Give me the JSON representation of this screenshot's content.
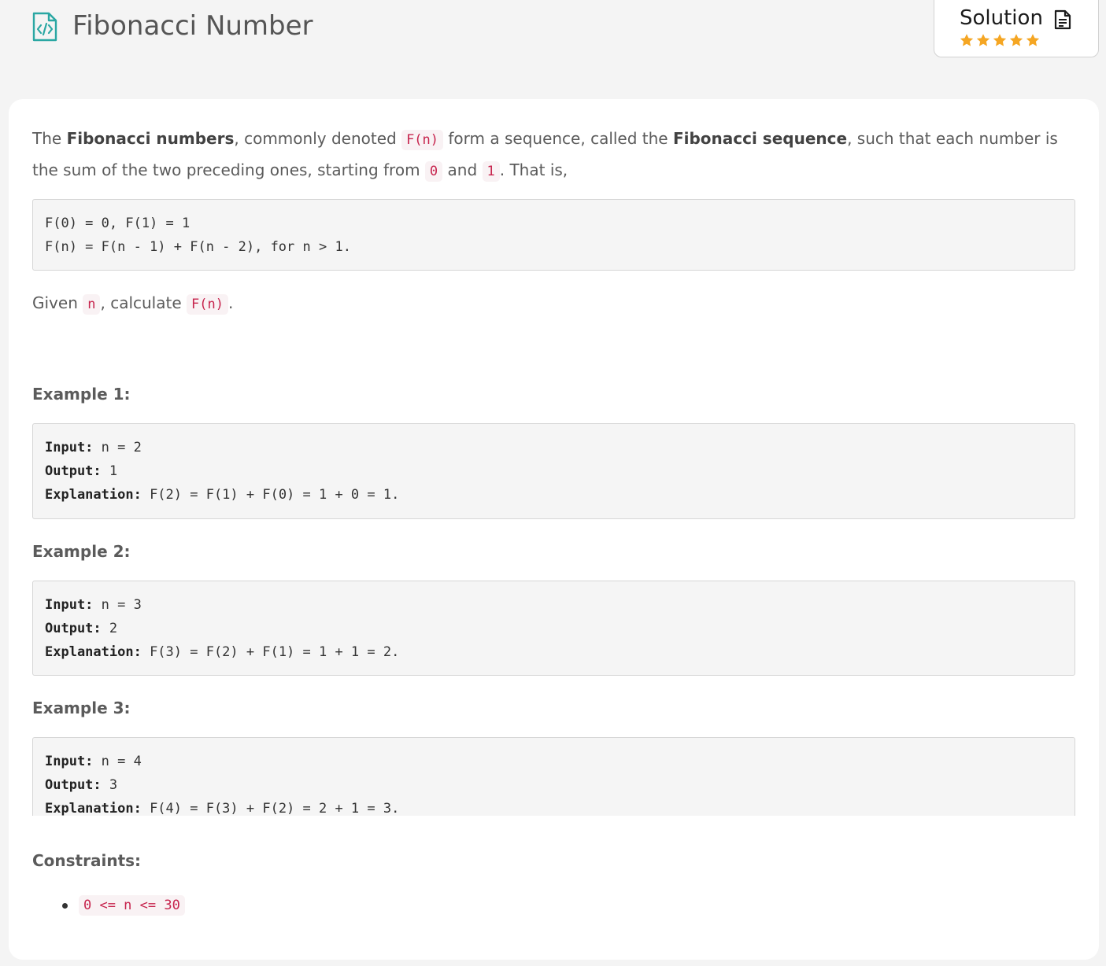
{
  "header": {
    "title": "Fibonacci Number",
    "title_icon": "code-file-icon",
    "solution": {
      "label": "Solution",
      "icon": "document-icon",
      "rating": 5,
      "rating_max": 5,
      "star_color": "#f5a623"
    }
  },
  "problem": {
    "intro": {
      "p1": "The ",
      "bold1": "Fibonacci numbers",
      "p2": ", commonly denoted ",
      "code1": "F(n)",
      "p3": " form a sequence, called the ",
      "bold2": "Fibonacci sequence",
      "p4": ", such that each number is the sum of the two preceding ones, starting from ",
      "code2": "0",
      "p5": " and ",
      "code3": "1",
      "p6": ". That is,"
    },
    "definition": {
      "line1": "F(0) = 0, F(1) = 1",
      "line2": "F(n) = F(n - 1) + F(n - 2), for n > 1."
    },
    "given": {
      "p1": "Given ",
      "code1": "n",
      "p2": ", calculate ",
      "code2": "F(n)",
      "p3": "."
    },
    "examples": [
      {
        "heading": "Example 1:",
        "input_label": "Input:",
        "input": " n = 2",
        "output_label": "Output:",
        "output": " 1",
        "explanation_label": "Explanation:",
        "explanation": " F(2) = F(1) + F(0) = 1 + 0 = 1."
      },
      {
        "heading": "Example 2:",
        "input_label": "Input:",
        "input": " n = 3",
        "output_label": "Output:",
        "output": " 2",
        "explanation_label": "Explanation:",
        "explanation": " F(3) = F(2) + F(1) = 1 + 1 = 2."
      },
      {
        "heading": "Example 3:",
        "input_label": "Input:",
        "input": " n = 4",
        "output_label": "Output:",
        "output": " 3",
        "explanation_label": "Explanation:",
        "explanation": " F(4) = F(3) + F(2) = 2 + 1 = 3."
      }
    ],
    "constraints": {
      "heading": "Constraints:",
      "items": [
        "0 <= n <= 30"
      ]
    }
  },
  "colors": {
    "accent_teal": "#2aa7a3",
    "code_red": "#c7254e",
    "code_bg": "#f9f2f4"
  }
}
